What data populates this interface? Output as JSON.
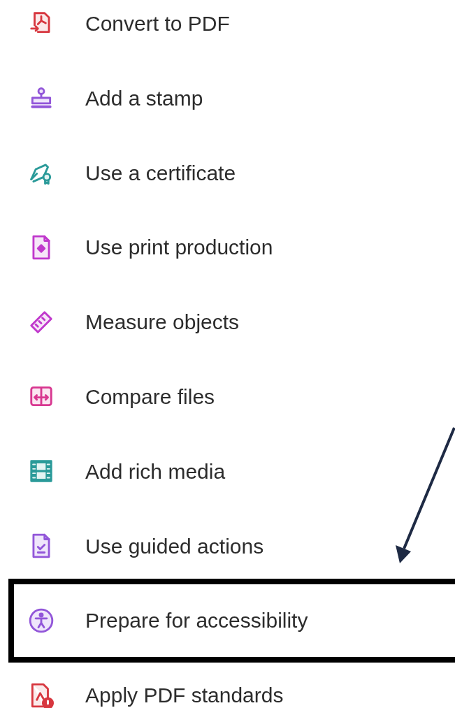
{
  "tools": [
    {
      "label": "Convert to PDF",
      "kind": "convert",
      "selected": false
    },
    {
      "label": "Add a stamp",
      "kind": "stamp",
      "selected": false
    },
    {
      "label": "Use a certificate",
      "kind": "certificate",
      "selected": false
    },
    {
      "label": "Use print production",
      "kind": "print",
      "selected": false
    },
    {
      "label": "Measure objects",
      "kind": "measure",
      "selected": false
    },
    {
      "label": "Compare files",
      "kind": "compare",
      "selected": false
    },
    {
      "label": "Add rich media",
      "kind": "media",
      "selected": false
    },
    {
      "label": "Use guided actions",
      "kind": "guided",
      "selected": false
    },
    {
      "label": "Prepare for accessibility",
      "kind": "accessibility",
      "selected": true
    },
    {
      "label": "Apply PDF standards",
      "kind": "standards",
      "selected": false
    }
  ]
}
